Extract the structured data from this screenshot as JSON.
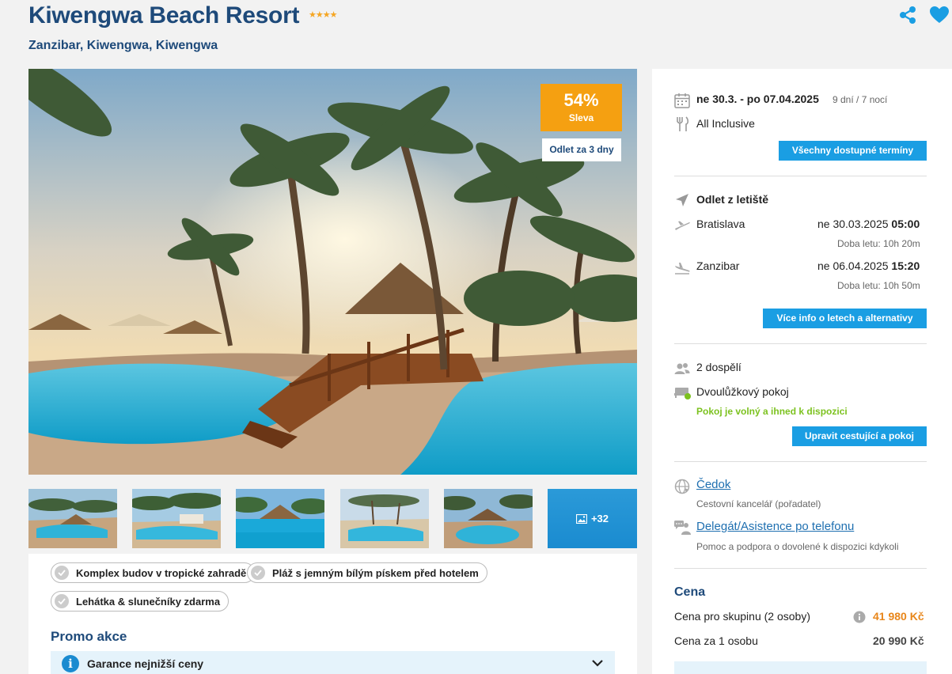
{
  "hotel": {
    "name": "Kiwengwa Beach Resort",
    "stars": "★★★★",
    "location": "Zanzibar, Kiwengwa, Kiwengwa"
  },
  "badges": {
    "discount_pct": "54%",
    "discount_label": "Sleva",
    "depart_in": "Odlet za 3 dny"
  },
  "gallery": {
    "more_label": "+32"
  },
  "features": [
    "Komplex budov v tropické zahradě",
    "Pláž s jemným bílým pískem před hotelem",
    "Lehátka & slunečníky zdarma"
  ],
  "promo": {
    "title": "Promo akce",
    "item": "Garance nejnižší ceny"
  },
  "trip": {
    "dates": "ne 30.3. - po 07.04.2025",
    "duration": "9 dní / 7 nocí",
    "board": "All Inclusive",
    "all_dates_button": "Všechny dostupné termíny"
  },
  "flights": {
    "heading": "Odlet z letiště",
    "outbound": {
      "city": "Bratislava",
      "date": "ne 30.03.2025",
      "time": "05:00",
      "duration": "Doba letu: 10h 20m"
    },
    "inbound": {
      "city": "Zanzibar",
      "date": "ne 06.04.2025",
      "time": "15:20",
      "duration": "Doba letu: 10h 50m"
    },
    "more_button": "Více info o letech a alternativy"
  },
  "travellers": {
    "count": "2 dospělí",
    "room": "Dvoulůžkový pokoj",
    "availability": "Pokoj je volný a ihned k dispozici",
    "edit_button": "Upravit cestující a pokoj"
  },
  "agency": {
    "name": "Čedok",
    "role": "Cestovní kancelář (pořadatel)",
    "support_link": "Delegát/Asistence po telefonu",
    "support_desc": "Pomoc a podpora o dovolené k dispozici kdykoli"
  },
  "price": {
    "title": "Cena",
    "group_label": "Cena pro skupinu (2 osoby)",
    "group_value": "41 980 Kč",
    "person_label": "Cena za 1 osobu",
    "person_value": "20 990 Kč"
  },
  "colors": {
    "brand": "#1e4a7a",
    "accent": "#1a9ee3",
    "discount": "#f5a011",
    "price": "#e8861a",
    "available": "#7cc21f"
  }
}
